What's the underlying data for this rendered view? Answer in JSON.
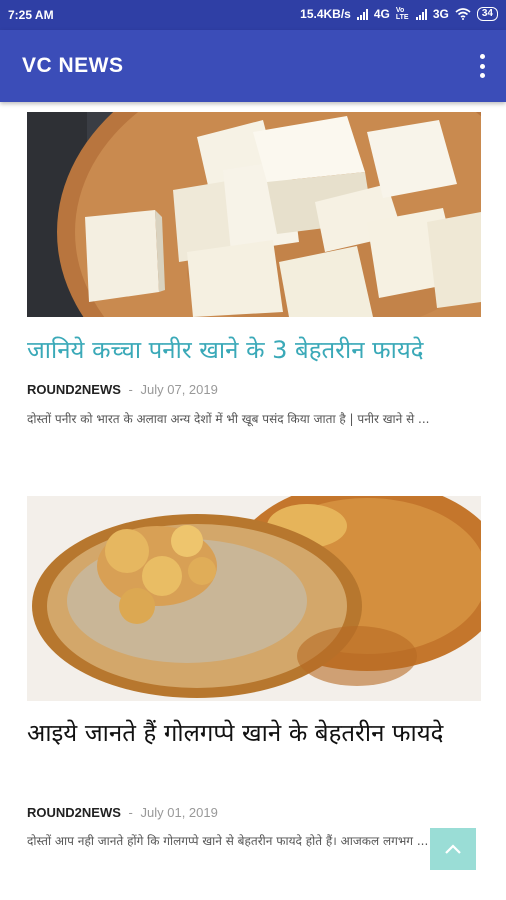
{
  "status_bar": {
    "time": "7:25 AM",
    "net_speed": "15.4KB/s",
    "network_1": "4G",
    "network_2": "3G",
    "volte": "Vo LTE",
    "battery": "34"
  },
  "app_bar": {
    "title": "VC NEWS",
    "menu_icon": "more-vert-icon"
  },
  "articles": [
    {
      "title": "जानिये कच्चा पनीर खाने के 3 बेहतरीन फायदे",
      "author": "ROUND2NEWS",
      "separator": "-",
      "date": "July 07, 2019",
      "excerpt": "दोस्तों पनीर को भारत के अलावा अन्य देशों में भी खूब पसंद किया जाता है | पनीर खाने से ...",
      "title_color": "#3aa9b8"
    },
    {
      "title": "आइये जानते हैं गोलगप्पे खाने के बेहतरीन फायदे",
      "author": "ROUND2NEWS",
      "separator": "-",
      "date": "July 01, 2019",
      "excerpt": "दोस्तों आप नही जानते होंगे कि गोलगप्पे खाने से बेहतरीन फायदे होते हैं। आजकल लगभग ...",
      "title_color": "#111111"
    }
  ],
  "colors": {
    "status_bar": "#2f3fa5",
    "app_bar": "#3b4db8",
    "scroll_top_button": "#78d2c8"
  },
  "scroll_top_icon": "chevron-up-icon"
}
